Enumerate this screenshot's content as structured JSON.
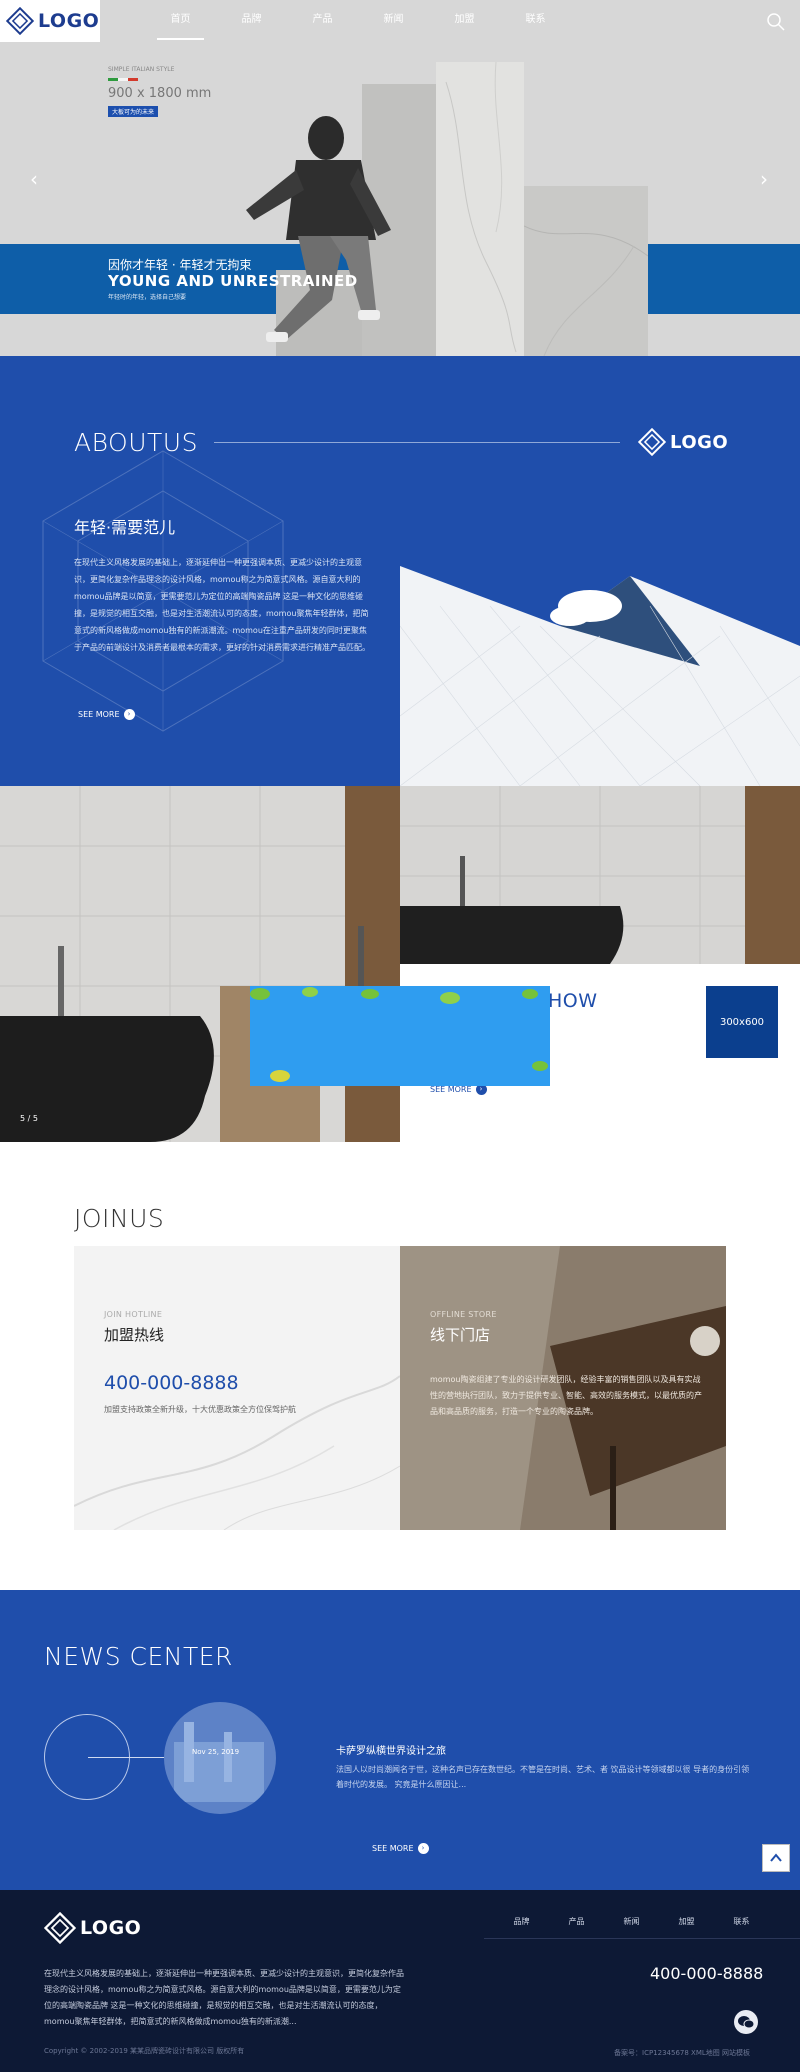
{
  "header": {
    "logo": "LOGO",
    "nav": [
      "首页",
      "品牌",
      "产品",
      "新闻",
      "加盟",
      "联系"
    ]
  },
  "hero": {
    "small": "SIMPLE ITALIAN STYLE",
    "size": "900 x 1800 mm",
    "tag": "大板可为的未来",
    "cn": "因你才年轻 · 年轻才无拘束",
    "en": "YOUNG AND UNRESTRAINED",
    "desc": "年轻时的年轻，选择自己想要"
  },
  "about": {
    "title": "ABOUTUS",
    "logo": "LOGO",
    "subtitle": "年轻·需要范儿",
    "text": "在现代主义风格发展的基础上，逐渐延伸出一种更强调本质、更减少设计的主观意识，更简化复杂作品理念的设计风格，momou称之为简意式风格。源自意大利的momou品牌是以简意，更需要范儿为定位的高端陶瓷品牌 这是一种文化的思维碰撞，是规觉的相互交融，也是对生活潮流认可的态度，momou聚焦年轻群体，把简意式的新风格做成momou独有的新派潮流。momou在注重产品研发的同时更聚焦于产品的前端设计及消费者最根本的需求，更好的针对消费需求进行精准产品匹配。",
    "see_more": "SEE MORE"
  },
  "showcase": {
    "counter": "5 / 5",
    "title": "HOW",
    "see_more": "SEE MORE",
    "size_label": "300x600"
  },
  "join": {
    "title": "JOINUS",
    "hotline_en": "JOIN HOTLINE",
    "hotline_cn": "加盟热线",
    "phone": "400-000-8888",
    "hotline_desc": "加盟支持政策全新升级，十大优惠政策全方位保驾护航",
    "store_en": "OFFLINE STORE",
    "store_cn": "线下门店",
    "store_text": "momou陶瓷组建了专业的设计研发团队，经验丰富的销售团队以及具有实战性的营地执行团队，致力于提供专业、智能、高效的服务模式，以最优质的产品和高品质的服务，打造一个专业的陶瓷品牌。"
  },
  "news": {
    "title": "NEWS CENTER",
    "date": "Nov 25, 2019",
    "headline": "卡萨罗纵横世界设计之旅",
    "text": "法国人以时尚潮闻名于世，这种名声已存在数世纪。不管是在时尚、艺术、者 饮品设计等领域都以很 导者的身份引领着时代的发展。 究竟是什么原因让...",
    "see_more": "SEE MORE"
  },
  "footer": {
    "logo": "LOGO",
    "nav": [
      "品牌",
      "产品",
      "新闻",
      "加盟",
      "联系"
    ],
    "phone": "400-000-8888",
    "text": "在现代主义风格发展的基础上，逐渐延伸出一种更强调本质、更减少设计的主观意识，更简化复杂作品理念的设计风格，momou称之为简意式风格。源自意大利的momou品牌是以简意，更需要范儿为定位的高端陶瓷品牌 这是一种文化的思维碰撞，是规觉的相互交融，也是对生活潮流认可的态度，momou聚焦年轻群体，把简意式的新风格做成momou独有的新派潮...",
    "copyright": "Copyright © 2002-2019 某某品牌瓷砖设计有限公司 版权所有",
    "icp": "备案号：ICP12345678 XML地图 网站模板"
  },
  "colors": {
    "brand_blue": "#1f4eab",
    "hero_band": "#0e5ea8",
    "footer_bg": "#0d1935"
  }
}
